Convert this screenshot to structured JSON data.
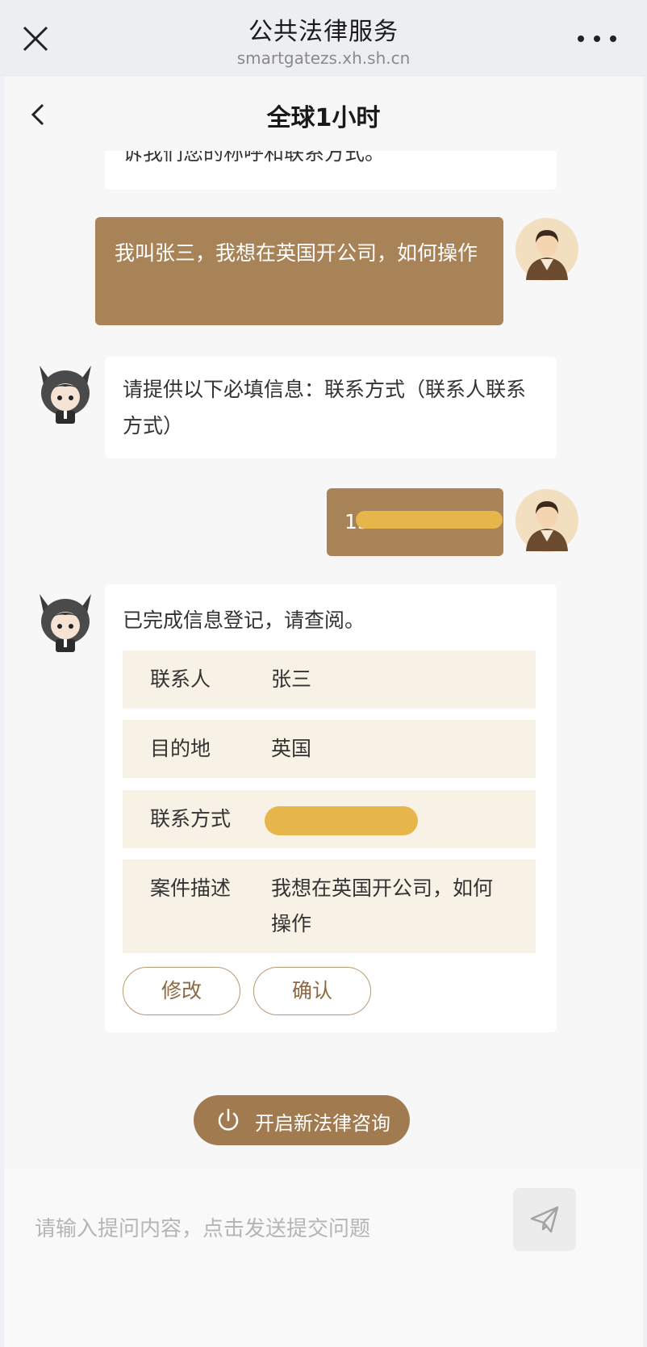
{
  "browser": {
    "title": "公共法律服务",
    "url": "smartgatezs.xh.sh.cn",
    "close_icon": "close-icon",
    "more_icon": "more-dots-icon"
  },
  "nav": {
    "title": "全球1小时",
    "back_icon": "chevron-left-icon"
  },
  "messages": {
    "bot_partial": "诉我们您的称呼和联系方式。",
    "user_1": "我叫张三，我想在英国开公司，如何操作",
    "bot_2": "请提供以下必填信息：联系方式（联系人联系方式）",
    "user_2_phone": "15",
    "bot_3_intro": "已完成信息登记，请查阅。"
  },
  "info_table": [
    {
      "key": "联系人",
      "value": "张三"
    },
    {
      "key": "目的地",
      "value": "英国"
    },
    {
      "key": "联系方式",
      "value": ""
    },
    {
      "key": "案件描述",
      "value": "我想在英国开公司，如何操作"
    }
  ],
  "actions": {
    "edit": "修改",
    "confirm": "确认",
    "new_consult": "开启新法律咨询"
  },
  "input": {
    "placeholder": "请输入提问内容，点击发送提交问题"
  },
  "colors": {
    "user_bubble": "#a88358",
    "accent": "#a17b4f",
    "info_row_bg": "#f7f1e6",
    "redaction": "#e6b64a"
  }
}
